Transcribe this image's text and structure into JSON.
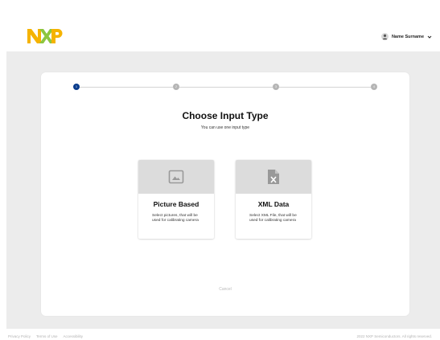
{
  "header": {
    "logo_text": "NXP",
    "user_name": "Name Surname",
    "colors": {
      "logo_n": "#f5b300",
      "logo_x": "#8dc63f",
      "logo_p": "#f5b300"
    }
  },
  "stepper": {
    "steps": [
      {
        "label": "1",
        "active": true
      },
      {
        "label": "2",
        "active": false
      },
      {
        "label": "3",
        "active": false
      },
      {
        "label": "4",
        "active": false
      }
    ],
    "active_color": "#0a3c8c"
  },
  "main": {
    "title": "Choose Input Type",
    "subtitle": "You can use one input type",
    "options": [
      {
        "icon": "image-icon",
        "title": "Picture Based",
        "description": "Select pictures, that will be used for calibrating camera"
      },
      {
        "icon": "xml-file-icon",
        "title": "XML Data",
        "description": "Select XML File, that will be used for calibrating camera"
      }
    ],
    "cancel_label": "Cancel"
  },
  "footer": {
    "links": [
      "Privacy Policy",
      "Terms of Use",
      "Accessibility"
    ],
    "copyright": "2022 NXP Semiconductors. All rights reserved."
  }
}
